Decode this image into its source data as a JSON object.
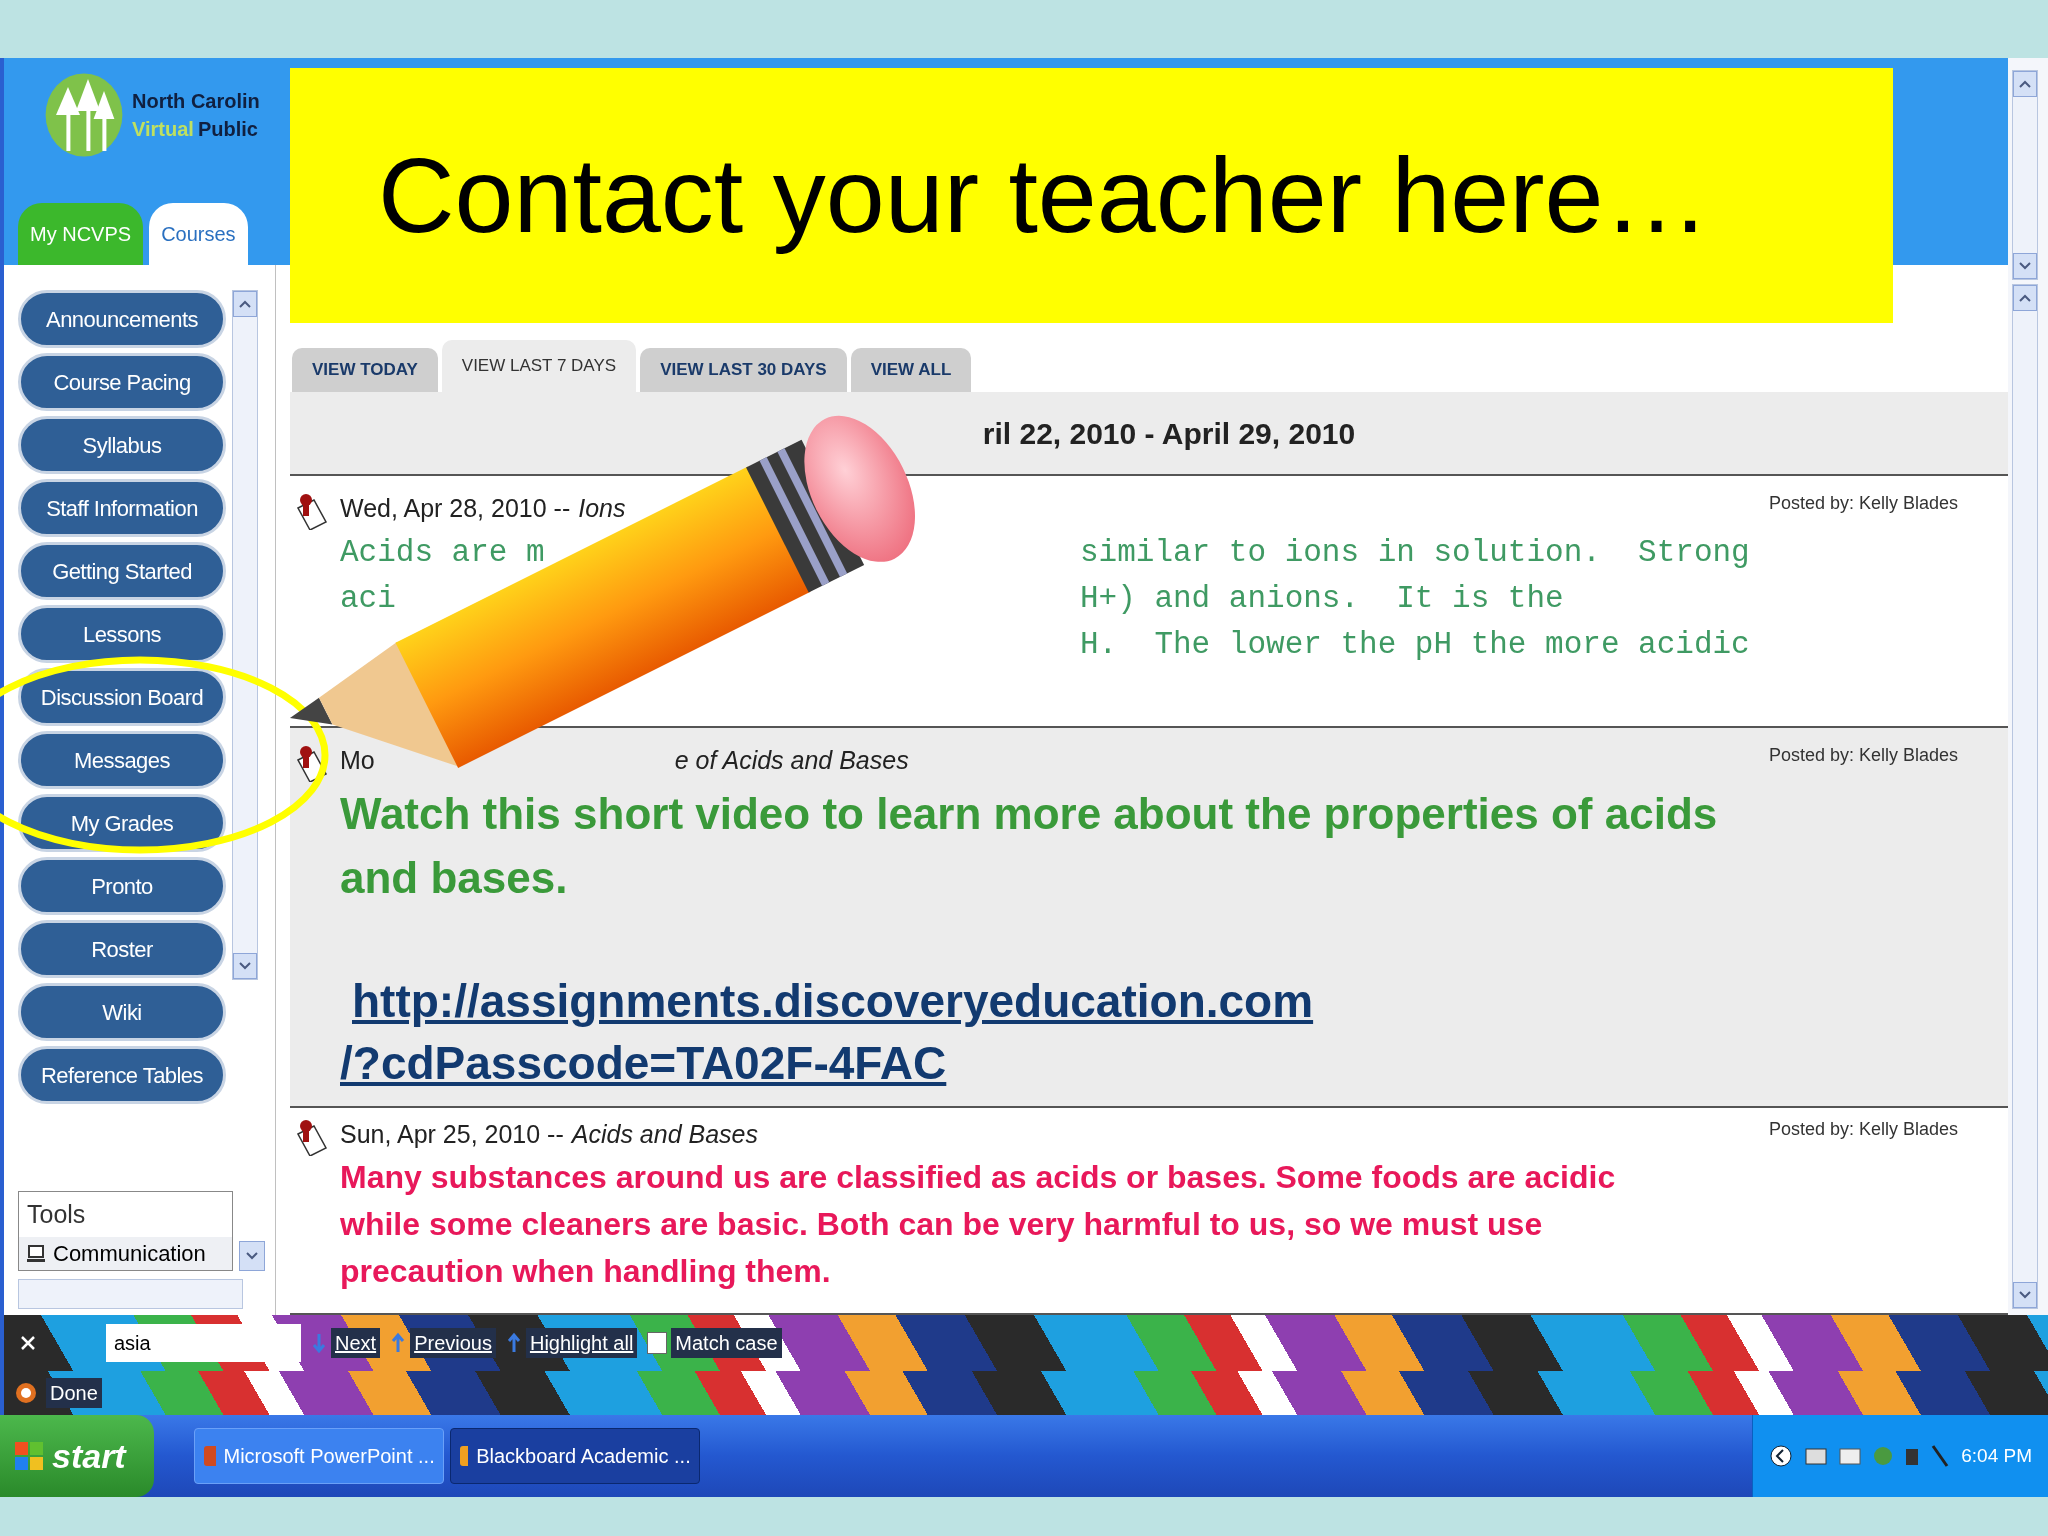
{
  "banner": {
    "text": "Contact your teacher here…"
  },
  "header": {
    "logo_lines": [
      "North Carolin",
      "Virtual",
      "Public"
    ],
    "tabs": [
      {
        "label": "My NCVPS",
        "selected": false
      },
      {
        "label": "Courses",
        "selected": true
      }
    ]
  },
  "sidebar": {
    "items": [
      "Announcements",
      "Course Pacing",
      "Syllabus",
      "Staff Information",
      "Getting Started",
      "Lessons",
      "Discussion Board",
      "Messages",
      "My Grades",
      "Pronto",
      "Roster",
      "Wiki",
      "Reference Tables"
    ],
    "tools": {
      "title": "Tools",
      "items": [
        "Communication"
      ]
    }
  },
  "view_tabs": [
    {
      "label": "VIEW TODAY",
      "selected": false
    },
    {
      "label": "VIEW LAST 7 DAYS",
      "selected": true
    },
    {
      "label": "VIEW LAST 30 DAYS",
      "selected": false
    },
    {
      "label": "VIEW ALL",
      "selected": false
    }
  ],
  "date_range": "ril 22, 2010 - April 29, 2010",
  "posts": [
    {
      "kind": "fragments",
      "date": "Wed, Apr 28, 2010 --",
      "topic": "Ions",
      "header_covered": false,
      "posted_by": "Posted by: Kelly Blades",
      "color": "#3f9a63",
      "shaded": false,
      "lines": [
        {
          "left": "Acids are m",
          "right": "similar to ions in solution.  Strong"
        },
        {
          "left": "aci",
          "right": "H+) and anions.  It is the"
        },
        {
          "right": "H.  The lower the pH the more acidic"
        }
      ]
    },
    {
      "kind": "video",
      "date": "Mo",
      "topic": "e of Acids and Bases",
      "header_covered": true,
      "posted_by": "Posted by: Kelly Blades",
      "color": "#3a9a3a",
      "shaded": true,
      "text": "Watch this short video to learn more about the properties of acids and bases.",
      "link_lines": [
        "http://assignments.discoveryeducation.com",
        "/?cdPasscode=TA02F-4FAC"
      ]
    },
    {
      "kind": "text",
      "date": "Sun, Apr 25, 2010 --",
      "topic": "Acids and Bases",
      "header_covered": false,
      "posted_by": "Posted by: Kelly Blades",
      "color": "#e8185a",
      "shaded": false,
      "text": "Many substances around us are classified as acids or bases.  Some foods are acidic while some cleaners are basic.  Both can be very harmful to us, so we must use precaution when handling them."
    }
  ],
  "find_bar": {
    "value": "asia",
    "buttons": [
      "Next",
      "Previous",
      "Highlight all"
    ],
    "match_case": {
      "label": "Match case",
      "checked": false
    }
  },
  "status": "Done",
  "taskbar": {
    "start": "start",
    "tasks": [
      {
        "label": "Microsoft PowerPoint ...",
        "selected": false
      },
      {
        "label": "Blackboard Academic ...",
        "selected": true
      }
    ],
    "clock": "6:04 PM"
  }
}
